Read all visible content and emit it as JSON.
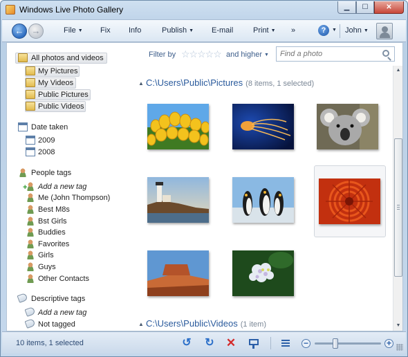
{
  "window": {
    "title": "Windows Live Photo Gallery",
    "controls": {
      "minimize": "▁",
      "maximize": "☐",
      "close": "✕"
    }
  },
  "commandbar": {
    "back_icon": "back-arrow-icon",
    "forward_icon": "forward-arrow-icon",
    "menus": [
      {
        "label": "File",
        "dropdown": true
      },
      {
        "label": "Fix",
        "dropdown": false
      },
      {
        "label": "Info",
        "dropdown": false
      },
      {
        "label": "Publish",
        "dropdown": true
      },
      {
        "label": "E-mail",
        "dropdown": false
      },
      {
        "label": "Print",
        "dropdown": true
      },
      {
        "label": "»",
        "dropdown": false
      }
    ],
    "help_glyph": "?",
    "user": "John"
  },
  "navpane": {
    "all_items": "All photos and videos",
    "folders": [
      "My Pictures",
      "My Videos",
      "Public Pictures",
      "Public Videos"
    ],
    "date_taken": {
      "label": "Date taken",
      "years": [
        "2009",
        "2008"
      ]
    },
    "people_tags": {
      "label": "People tags",
      "add": "Add a new tag",
      "items": [
        "Me (John Thompson)",
        "Best M8s",
        "Bst Girls",
        "Buddies",
        "Favorites",
        "Girls",
        "Guys",
        "Other Contacts"
      ]
    },
    "descriptive_tags": {
      "label": "Descriptive tags",
      "add": "Add a new tag",
      "not_tagged": "Not tagged"
    }
  },
  "filter": {
    "label": "Filter by",
    "stars": "☆☆☆☆☆",
    "and_higher": "and higher",
    "search_placeholder": "Find a photo"
  },
  "groups": [
    {
      "path": "C:\\Users\\Public\\Pictures",
      "count": "(8 items, 1 selected)",
      "thumbnails": [
        {
          "subject": "Tulips",
          "selected": false
        },
        {
          "subject": "Jellyfish",
          "selected": false
        },
        {
          "subject": "Koala",
          "selected": false
        },
        {
          "subject": "Lighthouse",
          "selected": false
        },
        {
          "subject": "Penguins",
          "selected": false
        },
        {
          "subject": "Chrysanthemum",
          "selected": true
        },
        {
          "subject": "Desert",
          "selected": false
        },
        {
          "subject": "Hydrangeas",
          "selected": false
        }
      ]
    },
    {
      "path": "C:\\Users\\Public\\Videos",
      "count": "(1 item)"
    }
  ],
  "statusbar": {
    "text": "10 items, 1 selected",
    "rotate_left": "↺",
    "rotate_right": "↻",
    "delete": "✕",
    "zoom_out": "−",
    "zoom_in": "+",
    "zoom_level": 0.3
  },
  "colors": {
    "accent": "#2a5a9c",
    "status_text": "#2d4a73",
    "delete": "#d42a2a"
  }
}
